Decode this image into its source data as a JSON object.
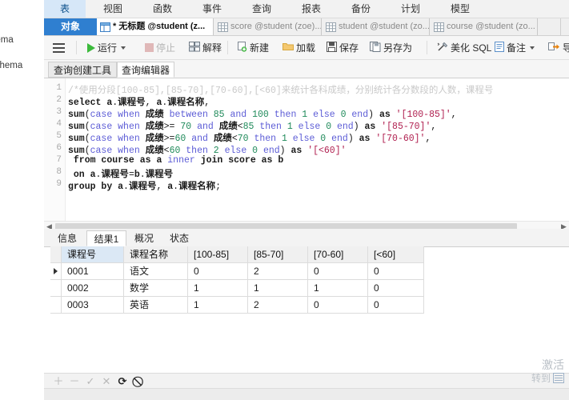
{
  "left_sidebar": {
    "items": [
      {
        "label": "hema"
      },
      {
        "label": "schema"
      }
    ]
  },
  "ribbon": {
    "tabs": [
      {
        "label": "表",
        "active": true
      },
      {
        "label": "视图",
        "active": false
      },
      {
        "label": "函数",
        "active": false
      },
      {
        "label": "事件",
        "active": false
      },
      {
        "label": "查询",
        "active": false
      },
      {
        "label": "报表",
        "active": false
      },
      {
        "label": "备份",
        "active": false
      },
      {
        "label": "计划",
        "active": false
      },
      {
        "label": "模型",
        "active": false
      }
    ]
  },
  "tabbar": {
    "object_tab": "对象",
    "documents": [
      {
        "label": "* 无标题 @student (z...",
        "icon": "query-icon",
        "selected": true
      },
      {
        "label": "score @student (zoe)...",
        "icon": "table-icon",
        "selected": false
      },
      {
        "label": "student @student (zo...",
        "icon": "table-icon",
        "selected": false
      },
      {
        "label": "course @student (zo...",
        "icon": "table-icon",
        "selected": false
      }
    ]
  },
  "toolbar": {
    "menu_icon": "hamburger-icon",
    "items": [
      {
        "label": "运行",
        "icon": "play-icon",
        "caret": true,
        "dim": false
      },
      {
        "label": "停止",
        "icon": "stop-icon",
        "caret": false,
        "dim": true
      },
      {
        "label": "解释",
        "icon": "explain-icon",
        "caret": false,
        "dim": false
      },
      {
        "label": "新建",
        "icon": "new-icon",
        "caret": false,
        "dim": false
      },
      {
        "label": "加载",
        "icon": "folder-icon",
        "caret": false,
        "dim": false
      },
      {
        "label": "保存",
        "icon": "save-icon",
        "caret": false,
        "dim": false
      },
      {
        "label": "另存为",
        "icon": "save-as-icon",
        "caret": false,
        "dim": false
      },
      {
        "label": "美化 SQL",
        "icon": "beautify-icon",
        "caret": false,
        "dim": false
      },
      {
        "label": "备注",
        "icon": "comment-icon",
        "caret": true,
        "dim": false
      },
      {
        "label": "导出",
        "icon": "export-icon",
        "caret": false,
        "dim": false
      }
    ]
  },
  "subtabs": [
    {
      "label": "查询创建工具",
      "active": false
    },
    {
      "label": "查询编辑器",
      "active": true
    }
  ],
  "editor": {
    "line_numbers": [
      "1",
      "2",
      "3",
      "4",
      "5",
      "6",
      "7",
      "8",
      "9"
    ],
    "lines": [
      "/*使用分段[100-85],[85-70],[70-60],[<60]来统计各科成绩，分别统计各分数段的人数，课程号",
      "select a.课程号, a.课程名称,",
      "sum(case when 成绩 between 85 and 100 then 1 else 0 end) as '[100-85]',",
      "sum(case when 成绩>= 70 and 成绩<85 then 1 else 0 end) as '[85-70]',",
      "sum(case when 成绩>=60 and 成绩<70 then 1 else 0 end) as '[70-60]',",
      "sum(case when 成绩<60 then 2 else 0 end) as '[<60]'",
      " from course as a inner join score as b",
      " on a.课程号=b.课程号",
      "group by a.课程号, a.课程名称;"
    ]
  },
  "result_tabs": [
    {
      "label": "信息",
      "active": false
    },
    {
      "label": "结果1",
      "active": true
    },
    {
      "label": "概况",
      "active": false
    },
    {
      "label": "状态",
      "active": false
    }
  ],
  "grid": {
    "columns": [
      "课程号",
      "课程名称",
      "[100-85]",
      "[85-70]",
      "[70-60]",
      "[<60]"
    ],
    "rows": [
      {
        "current": true,
        "cells": [
          "0001",
          "语文",
          "0",
          "2",
          "0",
          "0"
        ]
      },
      {
        "current": false,
        "cells": [
          "0002",
          "数学",
          "1",
          "1",
          "1",
          "0"
        ]
      },
      {
        "current": false,
        "cells": [
          "0003",
          "英语",
          "1",
          "2",
          "0",
          "0"
        ]
      }
    ]
  },
  "record_nav": {
    "buttons": [
      {
        "icon": "plus-icon",
        "name": "add-record-button",
        "glyph": "＋",
        "dark": false
      },
      {
        "icon": "minus-icon",
        "name": "delete-record-button",
        "glyph": "－",
        "dark": false
      },
      {
        "icon": "check-icon",
        "name": "apply-change-button",
        "glyph": "✓",
        "dark": false
      },
      {
        "icon": "cross-icon",
        "name": "discard-change-button",
        "glyph": "✕",
        "dark": false
      },
      {
        "icon": "refresh-icon",
        "name": "refresh-button",
        "glyph": "⟳",
        "dark": true
      },
      {
        "icon": "stop-circle-icon",
        "name": "stop-button",
        "glyph": "⃠",
        "dark": true
      }
    ]
  },
  "watermark": {
    "line1": "激活",
    "line2": "转到"
  },
  "colors": {
    "accent": "#2f7fd0",
    "ribbon_active": "#d6e7f8",
    "keyword": "#5c5cd6",
    "string": "#b02050",
    "number": "#1f8a5a",
    "comment": "#c9c9c9",
    "run_green": "#3cba3c"
  }
}
